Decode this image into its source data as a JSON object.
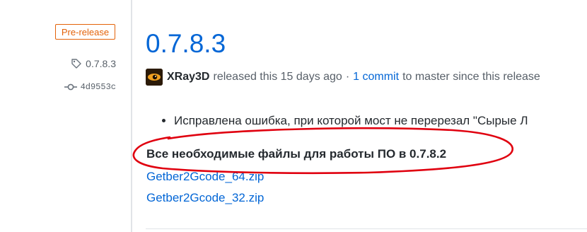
{
  "sidebar": {
    "badge": "Pre-release",
    "tag": "0.7.8.3",
    "commit": "4d9553c",
    "tag_icon": "tag-icon",
    "commit_icon": "git-commit-icon"
  },
  "release": {
    "title": "0.7.8.3",
    "author": "XRay3D",
    "released_text": "released this 15 days ago",
    "separator": "·",
    "commits_link": "1 commit",
    "commits_suffix": "to master since this release"
  },
  "notes": {
    "bullets": [
      "Исправлена ошибка, при которой мост не перерезал \"Сырые Л"
    ],
    "files_heading": "Все необходимые файлы для работы ПО в 0.7.8.2",
    "files": [
      "Getber2Gcode_64.zip",
      "Getber2Gcode_32.zip"
    ]
  },
  "colors": {
    "link": "#0366d6",
    "prerelease": "#e36209",
    "annotation": "#e0000f"
  }
}
